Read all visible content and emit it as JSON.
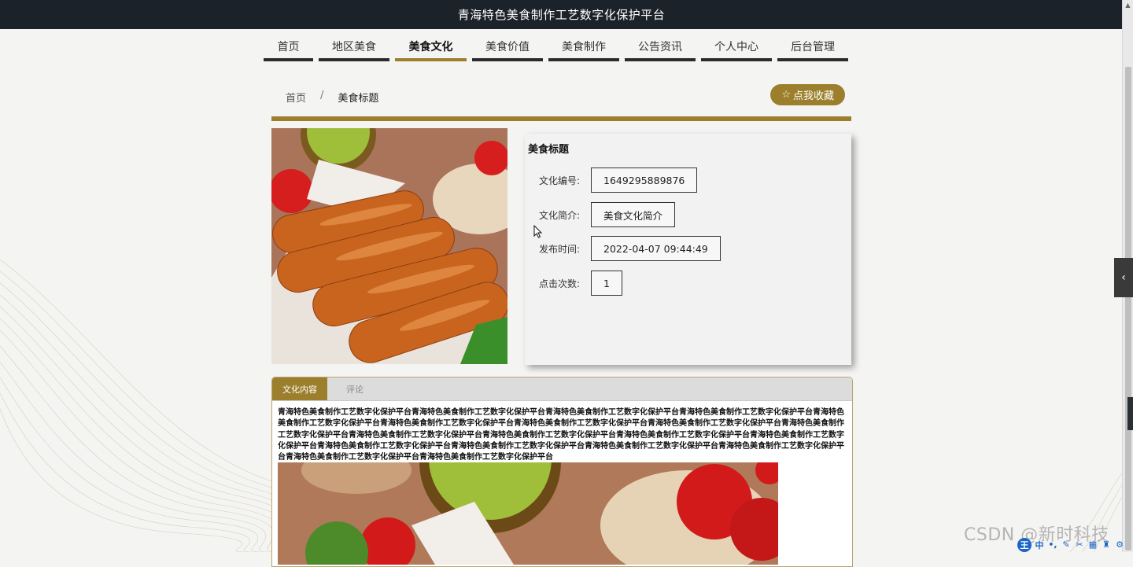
{
  "site_title": "青海特色美食制作工艺数字化保护平台",
  "nav": [
    {
      "label": "首页",
      "active": false
    },
    {
      "label": "地区美食",
      "active": false
    },
    {
      "label": "美食文化",
      "active": true
    },
    {
      "label": "美食价值",
      "active": false
    },
    {
      "label": "美食制作",
      "active": false
    },
    {
      "label": "公告资讯",
      "active": false
    },
    {
      "label": "个人中心",
      "active": false
    },
    {
      "label": "后台管理",
      "active": false
    }
  ],
  "breadcrumb": {
    "home": "首页",
    "separator": "/",
    "current": "美食标题"
  },
  "favorite_button": {
    "icon": "star-outline-icon",
    "label": "点我收藏"
  },
  "detail": {
    "title": "美食标题",
    "fields": [
      {
        "label": "文化编号:",
        "value": "1649295889876"
      },
      {
        "label": "文化简介:",
        "value": "美食文化简介"
      },
      {
        "label": "发布时间:",
        "value": "2022-04-07 09:44:49"
      },
      {
        "label": "点击次数:",
        "value": "1"
      }
    ]
  },
  "tabs": [
    {
      "label": "文化内容",
      "active": true
    },
    {
      "label": "评论",
      "active": false
    }
  ],
  "content_text": "青海特色美食制作工艺数字化保护平台青海特色美食制作工艺数字化保护平台青海特色美食制作工艺数字化保护平台青海特色美食制作工艺数字化保护平台青海特色美食制作工艺数字化保护平台青海特色美食制作工艺数字化保护平台青海特色美食制作工艺数字化保护平台青海特色美食制作工艺数字化保护平台青海特色美食制作工艺数字化保护平台青海特色美食制作工艺数字化保护平台青海特色美食制作工艺数字化保护平台青海特色美食制作工艺数字化保护平台青海特色美食制作工艺数字化保护平台青海特色美食制作工艺数字化保护平台青海特色美食制作工艺数字化保护平台青海特色美食制作工艺数字化保护平台青海特色美食制作工艺数字化保护平台青海特色美食制作工艺数字化保护平台青海特色美食制作工艺数字化保护平台",
  "watermark": "CSDN @新时科技",
  "ime": {
    "logo": "王",
    "mode": "中"
  },
  "colors": {
    "accent": "#9c7f2c",
    "topbar": "#1c222a",
    "background": "#f4f4f3"
  }
}
